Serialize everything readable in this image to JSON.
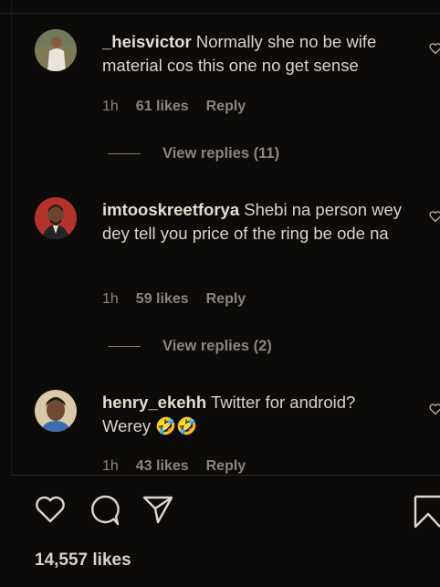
{
  "comments": [
    {
      "username": "_heisvictor",
      "text": "Normally she no be wife material cos this one no get sense",
      "time": "1h",
      "likes": "61 likes",
      "reply": "Reply",
      "view_replies": "View replies (11)"
    },
    {
      "username": "imtooskreetforya",
      "text": "Shebi na person wey dey tell you price of the ring be ode na",
      "time": "1h",
      "likes": "59 likes",
      "reply": "Reply",
      "view_replies": "View replies (2)"
    },
    {
      "username": "henry_ekehh",
      "text": "Twitter for android? Werey 🤣🤣",
      "time": "1h",
      "likes": "43 likes",
      "reply": "Reply"
    }
  ],
  "post": {
    "likes_total": "14,557 likes"
  },
  "icons": [
    "heart-icon",
    "comment-icon",
    "share-icon",
    "bookmark-icon"
  ],
  "colors": {
    "background": "#0c0b0a",
    "text": "#d9d3c9",
    "muted": "#8a857d"
  }
}
